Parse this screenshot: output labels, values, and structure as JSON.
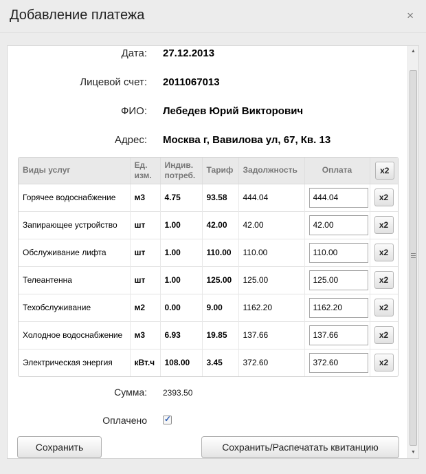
{
  "dialog": {
    "title": "Добавление платежа",
    "close_glyph": "×"
  },
  "fields": {
    "date": {
      "label": "Дата:",
      "value": "27.12.2013"
    },
    "account": {
      "label": "Лицевой счет:",
      "value": "2011067013"
    },
    "name": {
      "label": "ФИО:",
      "value": "Лебедев Юрий Викторович"
    },
    "address": {
      "label": "Адрес:",
      "value": "Москва г, Вавилова ул, 67, Кв. 13"
    }
  },
  "table": {
    "headers": {
      "service": "Виды услуг",
      "unit": "Ед. изм.",
      "consumption": "Индив. потреб.",
      "tariff": "Тариф",
      "debt": "Задолжность",
      "payment": "Оплата",
      "x2": "x2"
    },
    "rows": [
      {
        "service": "Горячее водоснабжение",
        "unit": "м3",
        "consumption": "4.75",
        "tariff": "93.58",
        "debt": "444.04",
        "payment": "444.04",
        "x2": "x2"
      },
      {
        "service": "Запирающее устройство",
        "unit": "шт",
        "consumption": "1.00",
        "tariff": "42.00",
        "debt": "42.00",
        "payment": "42.00",
        "x2": "x2"
      },
      {
        "service": "Обслуживание лифта",
        "unit": "шт",
        "consumption": "1.00",
        "tariff": "110.00",
        "debt": "110.00",
        "payment": "110.00",
        "x2": "x2"
      },
      {
        "service": "Телеантенна",
        "unit": "шт",
        "consumption": "1.00",
        "tariff": "125.00",
        "debt": "125.00",
        "payment": "125.00",
        "x2": "x2"
      },
      {
        "service": "Техобслуживание",
        "unit": "м2",
        "consumption": "0.00",
        "tariff": "9.00",
        "debt": "1162.20",
        "payment": "1162.20",
        "x2": "x2"
      },
      {
        "service": "Холодное водоснабжение",
        "unit": "м3",
        "consumption": "6.93",
        "tariff": "19.85",
        "debt": "137.66",
        "payment": "137.66",
        "x2": "x2"
      },
      {
        "service": "Электрическая энергия",
        "unit": "кВт.ч",
        "consumption": "108.00",
        "tariff": "3.45",
        "debt": "372.60",
        "payment": "372.60",
        "x2": "x2"
      }
    ]
  },
  "total": {
    "label": "Сумма:",
    "value": "2393.50"
  },
  "paid": {
    "label": "Оплачено",
    "checked": true,
    "check_glyph": "✓"
  },
  "buttons": {
    "save": "Сохранить",
    "save_print": "Сохранить/Распечатать квитанцию"
  },
  "scrollbar": {
    "up_glyph": "▲",
    "down_glyph": "▼"
  }
}
